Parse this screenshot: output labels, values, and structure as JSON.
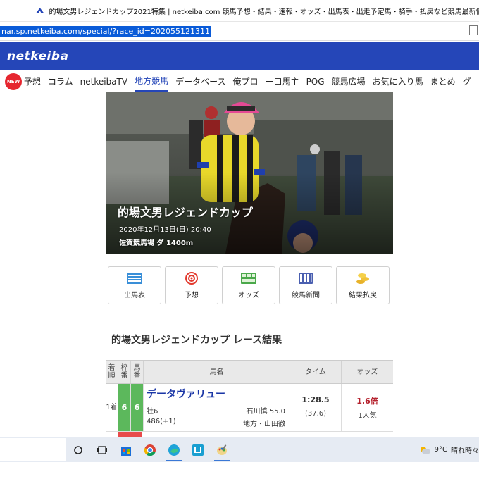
{
  "browser": {
    "tab_title": "的場文男レジェンドカップ2021特集 | netkeiba.com 競馬予想・結果・速報・オッズ・出馬表・出走予定馬・騎手・払戻など競馬最新情報！",
    "url": "nar.sp.netkeiba.com/special/?race_id=202055121311"
  },
  "site": {
    "brand": "netkeiba",
    "accent_color": "#2546b8"
  },
  "nav": {
    "new_badge": "NEW",
    "items": [
      "予想",
      "コラム",
      "netkeibaTV",
      "地方競馬",
      "データベース",
      "俺プロ",
      "一口馬主",
      "POG",
      "競馬広場",
      "お気に入り馬",
      "まとめ",
      "グ"
    ],
    "active_index": 3
  },
  "hero": {
    "title": "的場文男レジェンドカップ",
    "datetime": "2020年12月13日(日) 20:40",
    "venue": "佐賀競馬場 ダ 1400m"
  },
  "menu": [
    {
      "label": "出馬表",
      "icon": "entry-table-icon"
    },
    {
      "label": "予想",
      "icon": "target-icon"
    },
    {
      "label": "オッズ",
      "icon": "odds-board-icon"
    },
    {
      "label": "競馬新聞",
      "icon": "newspaper-icon"
    },
    {
      "label": "結果払戻",
      "icon": "coins-icon"
    }
  ],
  "results": {
    "title": "的場文男レジェンドカップ レース結果",
    "headers": {
      "rank": "着順",
      "waku": "枠番",
      "umaban": "馬番",
      "horse": "馬名",
      "time": "タイム",
      "odds": "オッズ"
    },
    "rows": [
      {
        "rank": "1着",
        "waku": "6",
        "umaban": "6",
        "horse": "データヴァリュー",
        "sex_age": "牡6",
        "weight": "486(+1)",
        "jockey": "石川慎 55.0",
        "trainer": "地方・山田徹",
        "time": "1:28.5",
        "last3f": "(37.6)",
        "odds": "1.6倍",
        "popularity": "1人気"
      }
    ]
  },
  "taskbar": {
    "temperature": "9°C",
    "weather": "晴れ時々"
  }
}
